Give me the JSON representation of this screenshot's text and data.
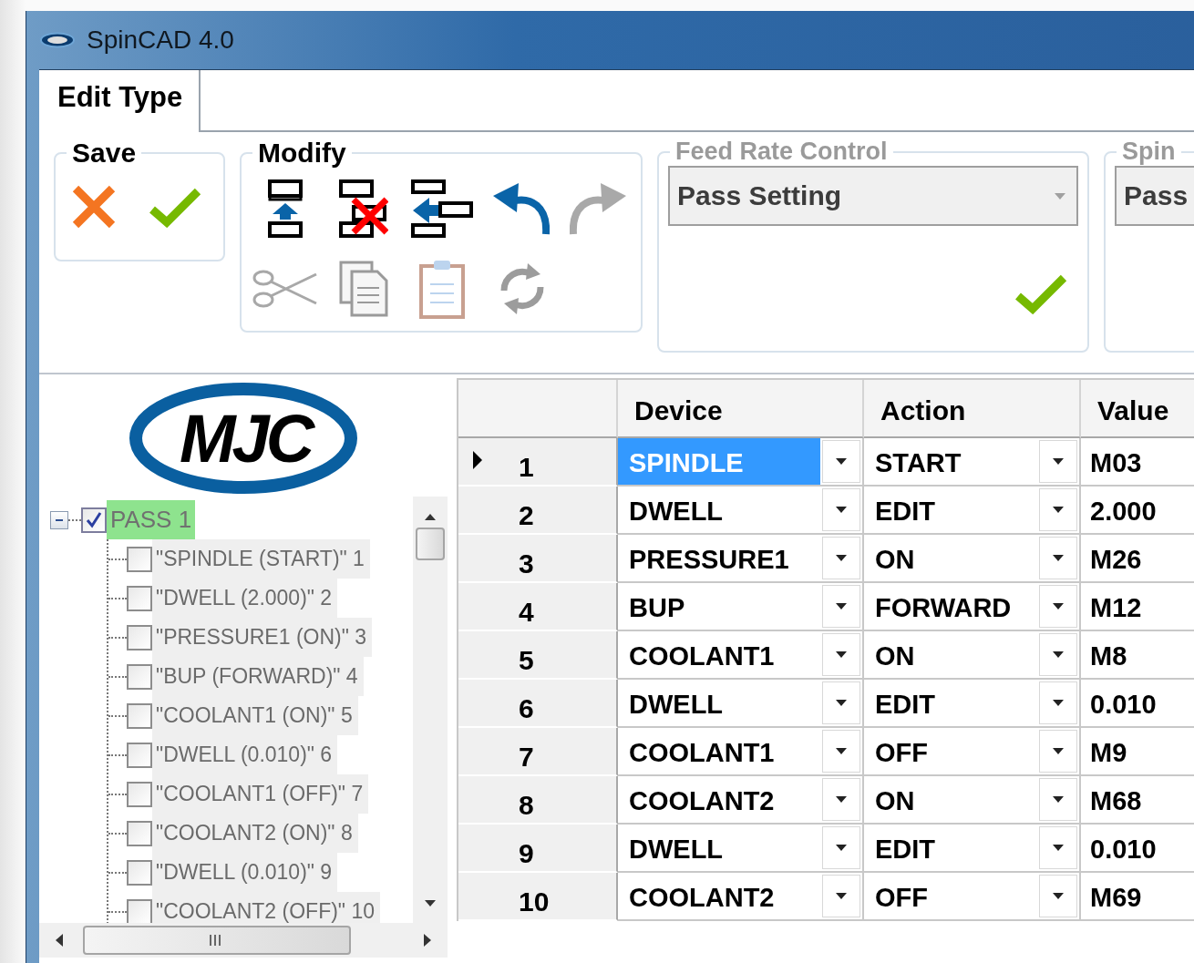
{
  "window": {
    "title": "SpinCAD 4.0"
  },
  "tabs": [
    {
      "label": "Edit Type",
      "selected": true
    }
  ],
  "ribbon": {
    "groups": [
      {
        "kind": "save",
        "title": "Save",
        "disabled": false
      },
      {
        "kind": "modify",
        "title": "Modify",
        "disabled": false,
        "tools": [
          {
            "kind": "insert",
            "disabled": false
          },
          {
            "kind": "delete",
            "disabled": false
          },
          {
            "kind": "outdent",
            "disabled": false
          },
          {
            "kind": "undo",
            "disabled": false
          },
          {
            "kind": "redo",
            "disabled": true
          },
          {
            "kind": "cut",
            "disabled": true
          },
          {
            "kind": "copy",
            "disabled": true
          },
          {
            "kind": "paste",
            "disabled": true
          },
          {
            "kind": "refresh",
            "disabled": true
          }
        ]
      },
      {
        "kind": "combo",
        "title": "Feed Rate Control",
        "value": "Pass Setting",
        "disabled": true
      },
      {
        "kind": "combo",
        "title": "Spin",
        "value": "Pass",
        "disabled": true
      }
    ]
  },
  "logo": {
    "text": "MJC"
  },
  "tree": {
    "root": {
      "label": "PASS 1",
      "checked": true,
      "expanded": true,
      "selected": true,
      "children": [
        {
          "label": "\"SPINDLE (START)\" 1",
          "checked": false
        },
        {
          "label": "\"DWELL (2.000)\" 2",
          "checked": false
        },
        {
          "label": "\"PRESSURE1 (ON)\" 3",
          "checked": false
        },
        {
          "label": "\"BUP (FORWARD)\" 4",
          "checked": false
        },
        {
          "label": "\"COOLANT1 (ON)\" 5",
          "checked": false
        },
        {
          "label": "\"DWELL (0.010)\" 6",
          "checked": false
        },
        {
          "label": "\"COOLANT1 (OFF)\" 7",
          "checked": false
        },
        {
          "label": "\"COOLANT2 (ON)\" 8",
          "checked": false
        },
        {
          "label": "\"DWELL (0.010)\" 9",
          "checked": false
        },
        {
          "label": "\"COOLANT2 (OFF)\" 10",
          "checked": false
        }
      ]
    }
  },
  "grid": {
    "columns": [
      "Device",
      "Action",
      "Value"
    ],
    "rows": [
      {
        "number": "1",
        "device": "SPINDLE",
        "action": "START",
        "value": "M03",
        "selected": true
      },
      {
        "number": "2",
        "device": "DWELL",
        "action": "EDIT",
        "value": "2.000",
        "selected": false
      },
      {
        "number": "3",
        "device": "PRESSURE1",
        "action": "ON",
        "value": "M26",
        "selected": false
      },
      {
        "number": "4",
        "device": "BUP",
        "action": "FORWARD",
        "value": "M12",
        "selected": false
      },
      {
        "number": "5",
        "device": "COOLANT1",
        "action": "ON",
        "value": "M8",
        "selected": false
      },
      {
        "number": "6",
        "device": "DWELL",
        "action": "EDIT",
        "value": "0.010",
        "selected": false
      },
      {
        "number": "7",
        "device": "COOLANT1",
        "action": "OFF",
        "value": "M9",
        "selected": false
      },
      {
        "number": "8",
        "device": "COOLANT2",
        "action": "ON",
        "value": "M68",
        "selected": false
      },
      {
        "number": "9",
        "device": "DWELL",
        "action": "EDIT",
        "value": "0.010",
        "selected": false
      },
      {
        "number": "10",
        "device": "COOLANT2",
        "action": "OFF",
        "value": "M69",
        "selected": false
      }
    ]
  }
}
